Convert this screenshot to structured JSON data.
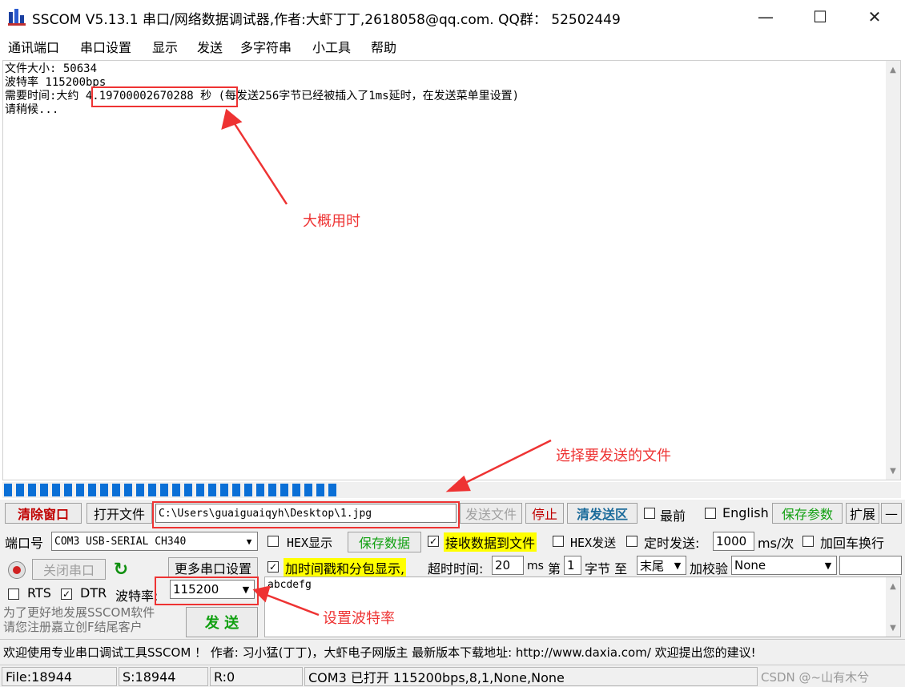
{
  "window": {
    "title": "SSCOM V5.13.1 串口/网络数据调试器,作者:大虾丁丁,2618058@qq.com. QQ群：  52502449",
    "minimize": "—",
    "maximize": "☐",
    "close": "✕"
  },
  "menu": [
    "通讯端口",
    "串口设置",
    "显示",
    "发送",
    "多字符串",
    "小工具",
    "帮助"
  ],
  "receive": {
    "lines": [
      "文件大小: 50634",
      "波特率 115200bps",
      "需要时间:大约 4.19700002670288 秒 (每发送256字节已经被插入了1ms延时，在发送菜单里设置)",
      "请稍候..."
    ]
  },
  "progress": {
    "blocks_filled": 28
  },
  "toolbar": {
    "clear_window": "清除窗口",
    "open_file": "打开文件",
    "file_path": "C:\\Users\\guaiguaiqyh\\Desktop\\1.jpg",
    "send_file": "发送文件",
    "stop": "停止",
    "clear_send": "清发送区",
    "topmost": "最前",
    "english": "English",
    "save_params": "保存参数",
    "expand": "扩展",
    "collapse": "—"
  },
  "port": {
    "port_label": "端口号",
    "port_value": "COM3 USB-SERIAL CH340",
    "hex_display": "HEX显示",
    "save_data": "保存数据",
    "recv_to_file": "接收数据到文件",
    "hex_send": "HEX发送",
    "timed_send": "定时发送:",
    "interval": "1000",
    "interval_unit": "ms/次",
    "add_crlf": "加回车换行",
    "close_port": "关闭串口",
    "more_settings": "更多串口设置",
    "timestamp": "加时间戳和分包显示,",
    "timeout_label": "超时时间:",
    "timeout_value": "20",
    "timeout_unit": "ms",
    "nth_label": "第",
    "nth_value": "1",
    "byte_to": "字节 至",
    "end_value": "末尾",
    "checksum_label": "加校验",
    "checksum_value": "None",
    "rts": "RTS",
    "dtr": "DTR",
    "baud_label": "波特率:",
    "baud_value": "115200",
    "promo": "为了更好地发展SSCOM软件\n请您注册嘉立创F结尾客户",
    "send": "发  送"
  },
  "send_text": "abcdefg",
  "banner": "欢迎使用专业串口调试工具SSCOM ！  作者: 习小猛(丁丁)，大虾电子网版主  最新版本下载地址: http://www.daxia.com/  欢迎提出您的建议!",
  "status": {
    "file": "File:18944",
    "sent": "S:18944",
    "recv": "R:0",
    "port_state": "COM3 已打开  115200bps,8,1,None,None",
    "watermark": "CSDN @~山有木兮"
  },
  "annotations": {
    "time": "大概用时",
    "file": "选择要发送的文件",
    "baud": "设置波特率"
  },
  "colors": {
    "accent": "#0a6fd6",
    "annotation": "#ee3333",
    "highlight": "#ffff00"
  }
}
